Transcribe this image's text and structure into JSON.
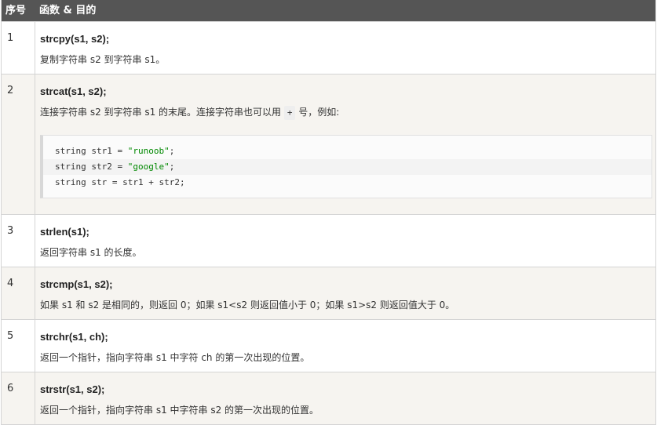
{
  "header": {
    "col_index": "序号",
    "col_func": "函数 & 目的"
  },
  "rows": [
    {
      "num": "1",
      "func": "strcpy(s1, s2);",
      "desc": "复制字符串 s2 到字符串 s1。"
    },
    {
      "num": "2",
      "func": "strcat(s1, s2);",
      "desc_pre": "连接字符串 s2 到字符串 s1 的末尾。连接字符串也可以用 ",
      "desc_op": "+",
      "desc_post": " 号，例如:",
      "code": [
        {
          "type": "string",
          "var": "str1",
          "value": "\"runoob\""
        },
        {
          "type": "string",
          "var": "str2",
          "value": "\"google\""
        },
        {
          "type": "string",
          "var": "str",
          "expr": "str1 + str2"
        }
      ]
    },
    {
      "num": "3",
      "func": "strlen(s1);",
      "desc": "返回字符串 s1 的长度。"
    },
    {
      "num": "4",
      "func": "strcmp(s1, s2);",
      "desc": "如果 s1 和 s2 是相同的，则返回 0；如果 s1<s2 则返回值小于 0；如果 s1>s2 则返回值大于 0。"
    },
    {
      "num": "5",
      "func": "strchr(s1, ch);",
      "desc": "返回一个指针，指向字符串 s1 中字符 ch 的第一次出现的位置。"
    },
    {
      "num": "6",
      "func": "strstr(s1, s2);",
      "desc": "返回一个指针，指向字符串 s1 中字符串 s2 的第一次出现的位置。"
    }
  ]
}
